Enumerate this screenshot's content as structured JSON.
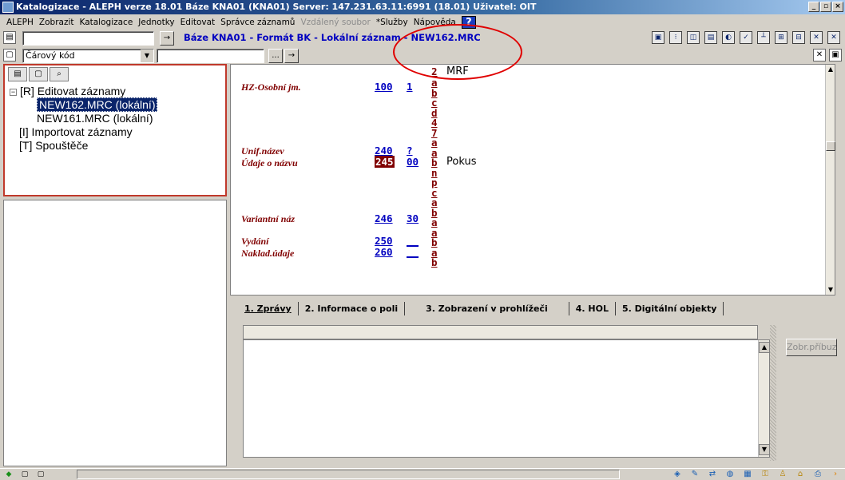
{
  "window": {
    "title": "Katalogizace - ALEPH verze 18.01  Báze KNA01 (KNA01)  Server: 147.231.63.11:6991 (18.01)  Uživatel: OIT",
    "controls": [
      "_",
      "▫",
      "×"
    ]
  },
  "menu": {
    "items": [
      "ALEPH",
      "Zobrazit",
      "Katalogizace",
      "Jednotky",
      "Editovat",
      "Správce záznamů"
    ],
    "disabled_item": "Vzdálený soubor",
    "items_after": [
      "*Služby",
      "Nápověda"
    ],
    "help_badge": "?"
  },
  "toolbar1": {
    "input_value": "",
    "record_title": "Báze KNA01 - Formát BK - Lokální záznam - NEW162.MRC",
    "tool_icons": [
      "save-record-icon",
      "tag-icon",
      "split-view-icon",
      "layout-icon",
      "refresh-icon",
      "check-icon",
      "tree-icon",
      "expand-icon",
      "collapse-icon",
      "close-window-icon",
      "exit-icon"
    ]
  },
  "toolbar2": {
    "barcode_label": "Čárový kód",
    "barcode_value": "",
    "ellipsis": "...",
    "go": "→"
  },
  "tree": {
    "root": "[R] Editovat záznamy",
    "records": [
      "NEW162.MRC (lokální)",
      "NEW161.MRC (lokální)"
    ],
    "other": [
      "[I] Importovat záznamy",
      "[T] Spouštěče"
    ]
  },
  "editor": {
    "top_sub": "2",
    "top_val": "MRF",
    "fields": [
      {
        "label": "HZ-Osobní jm.",
        "tag": "100",
        "ind": "1"
      },
      {
        "label": "Unif.název",
        "tag": "240",
        "ind": "?"
      },
      {
        "label": "Údaje o názvu",
        "tag": "245",
        "ind": "00",
        "value": "Pokus"
      },
      {
        "label": "Variantní náz",
        "tag": "246",
        "ind": "30"
      },
      {
        "label": "Vydání",
        "tag": "250",
        "ind": "__"
      },
      {
        "label": "Naklad.údaje",
        "tag": "260",
        "ind": "__"
      }
    ],
    "subfields": [
      "a",
      "b",
      "c",
      "d",
      "4",
      "7",
      "a",
      "a",
      "b",
      "n",
      "p",
      "c",
      "a",
      "b",
      "a",
      "a",
      "b",
      "a",
      "b"
    ]
  },
  "bottom": {
    "tabs": [
      "1. Zprávy",
      "2. Informace o poli",
      "3. Zobrazení v prohlížeči",
      "4. HOL",
      "5. Digitální objekty"
    ],
    "related_button": "Zobr.příbuz."
  },
  "colors": {
    "accent": "#0a246a",
    "field_label": "#800000",
    "tag": "#0000c0",
    "annotation": "#e00000"
  }
}
